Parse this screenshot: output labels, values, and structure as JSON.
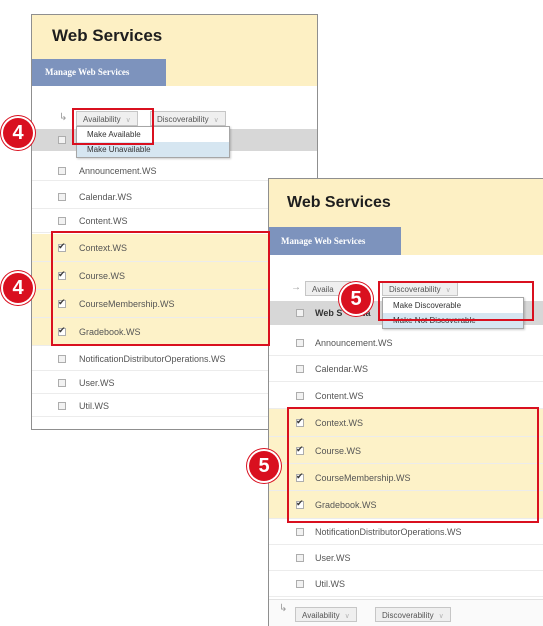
{
  "left_panel": {
    "title": "Web Services",
    "tab": "Manage Web Services",
    "availability_label": "Availability",
    "discoverability_label": "Discoverability",
    "availability_menu": [
      "Make Available",
      "Make Unavailable"
    ],
    "rows": [
      {
        "label": "Announcement.WS",
        "checked": false
      },
      {
        "label": "Calendar.WS",
        "checked": false
      },
      {
        "label": "Content.WS",
        "checked": false
      },
      {
        "label": "Context.WS",
        "checked": true
      },
      {
        "label": "Course.WS",
        "checked": true
      },
      {
        "label": "CourseMembership.WS",
        "checked": true
      },
      {
        "label": "Gradebook.WS",
        "checked": true
      },
      {
        "label": "NotificationDistributorOperations.WS",
        "checked": false
      },
      {
        "label": "User.WS",
        "checked": false
      },
      {
        "label": "Util.WS",
        "checked": false
      }
    ]
  },
  "right_panel": {
    "title": "Web Services",
    "tab": "Manage Web Services",
    "availability_label": "Availa",
    "discoverability_label": "Discoverability",
    "discoverability_menu": [
      "Make Discoverable",
      "Make Not Discoverable"
    ],
    "column_header": "Web S",
    "column_header_tail": "Na",
    "rows": [
      {
        "label": "Announcement.WS",
        "checked": false
      },
      {
        "label": "Calendar.WS",
        "checked": false
      },
      {
        "label": "Content.WS",
        "checked": false
      },
      {
        "label": "Context.WS",
        "checked": true
      },
      {
        "label": "Course.WS",
        "checked": true
      },
      {
        "label": "CourseMembership.WS",
        "checked": true
      },
      {
        "label": "Gradebook.WS",
        "checked": true
      },
      {
        "label": "NotificationDistributorOperations.WS",
        "checked": false
      },
      {
        "label": "User.WS",
        "checked": false
      },
      {
        "label": "Util.WS",
        "checked": false
      }
    ],
    "bottom_availability_label": "Availability",
    "bottom_discoverability_label": "Discoverability"
  },
  "callouts": {
    "step_a": "4",
    "step_b": "5"
  },
  "colors": {
    "callout": "#d9101f",
    "selected_row": "#fdf2c8",
    "header": "#fdf0c4",
    "tab": "#7d93bd"
  },
  "icons": [
    "return-arrow-icon",
    "chevron-down-icon",
    "checkbox-icon"
  ]
}
